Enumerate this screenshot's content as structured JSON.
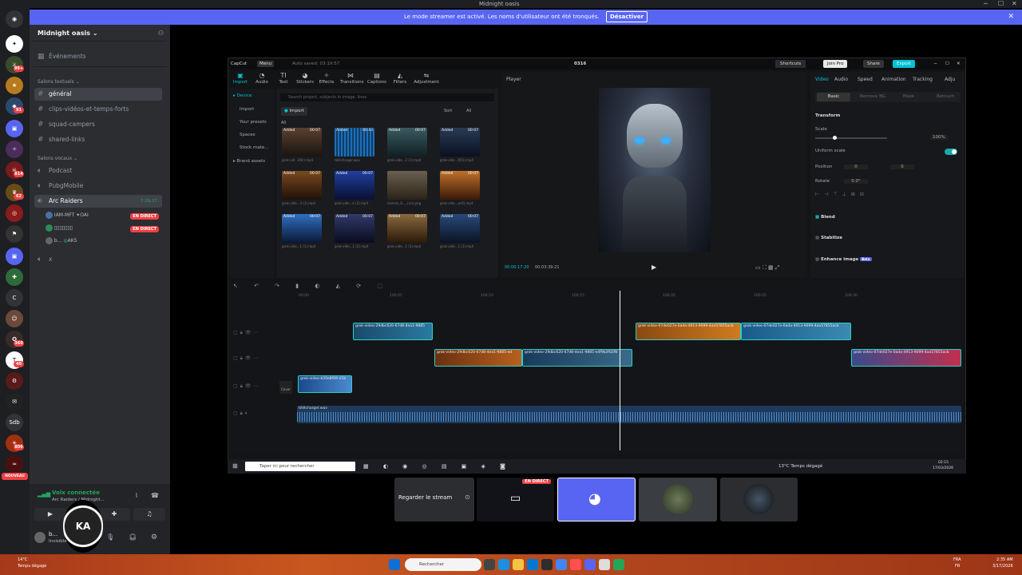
{
  "window": {
    "title": "Midnight oasis",
    "min": "─",
    "max": "☐",
    "close": "✕"
  },
  "guild_badges": [
    "99+",
    "91",
    "814",
    "62",
    "360",
    "40",
    "806"
  ],
  "guild_text": {
    "c": "C",
    "sdb": "Sdb",
    "new": "NOUVEAU"
  },
  "banner": {
    "text": "Le mode streamer est activé. Les noms d'utilisateur ont été tronqués.",
    "button": "Désactiver",
    "close": "✕"
  },
  "server": {
    "name": "Midnight oasis",
    "events": "Événements",
    "text_category": "Salons textuels",
    "text_channels": [
      "général",
      "clips-vidéos-et-temps-forts",
      "squad-campers",
      "shared-links"
    ],
    "voice_category": "Salons vocaux",
    "voice_channels": [
      "Podcast",
      "PubgMobile",
      "Arc Raiders"
    ],
    "active_time": "7:29:37",
    "voice_members": [
      {
        "name": "IAM-MFT",
        "tag": "OAI",
        "status": "EN DIRECT"
      },
      {
        "name": "▯▯▯▯▯▯▯",
        "tag": "",
        "status": "EN DIRECT"
      },
      {
        "name": "b...",
        "tag": "AKS",
        "status": ""
      }
    ],
    "last_channel": "x"
  },
  "voice": {
    "status": "Voix connectée",
    "channel": "Arc Raiders / Midnight..."
  },
  "user": {
    "name": "b...",
    "status": "Invisible"
  },
  "capcut": {
    "app": "CapCut",
    "menu": "Menu",
    "autosave": "Auto saved: 03:19:57",
    "project": "0316",
    "shortcuts": "Shortcuts",
    "join_pro": "Join Pro",
    "share": "Share",
    "export": "Export",
    "tools": [
      "Import",
      "Audio",
      "Text",
      "Stickers",
      "Effects",
      "Transitions",
      "Captions",
      "Filters",
      "Adjustment"
    ],
    "left_nav": [
      "Device",
      "Import",
      "Your presets",
      "Spaces",
      "Stock mate...",
      "Brand assets"
    ],
    "search_placeholder": "Search project, subjects in image, lines",
    "import_btn": "Import",
    "sort": "Sort",
    "all_label": "All",
    "all_filter": "All",
    "media": [
      {
        "label": "Added",
        "dur": "00:07",
        "file": "grok-vid...89c).mp4"
      },
      {
        "label": "Added",
        "dur": "00:43",
        "file": "télécharger.wav"
      },
      {
        "label": "Added",
        "dur": "00:07",
        "file": "grok-vide...2 (1).mp4"
      },
      {
        "label": "Added",
        "dur": "00:07",
        "file": "grok-vide...055).mp4"
      },
      {
        "label": "Added",
        "dur": "00:07",
        "file": "grok-vide...3 (1).mp4"
      },
      {
        "label": "Added",
        "dur": "00:07",
        "file": "grok-vide...k (2).mp4"
      },
      {
        "label": "",
        "dur": "",
        "file": "Gemini_G..._(no).png"
      },
      {
        "label": "Added",
        "dur": "00:07",
        "file": "grok-vide...ac6).mp4"
      },
      {
        "label": "Added",
        "dur": "00:07",
        "file": "grok-vide...1 (1).mp4"
      },
      {
        "label": "Added",
        "dur": "00:07",
        "file": "grok-vide...1 (2).mp4"
      },
      {
        "label": "Added",
        "dur": "00:07",
        "file": "grok-vide...1 (1).mp4"
      },
      {
        "label": "Added",
        "dur": "00:07",
        "file": "grok-vide...1 (1).mp4"
      }
    ],
    "player": {
      "title": "Player",
      "time": "00:00:17:20",
      "total": "00:03:39:21"
    },
    "right_tabs": [
      "Video",
      "Audio",
      "Speed",
      "Animation",
      "Tracking",
      "Adju"
    ],
    "sub_tabs": [
      "Basic",
      "Remove BG",
      "Mask",
      "Retouch"
    ],
    "transform": "Transform",
    "scale": "Scale",
    "scale_val": "100%",
    "uniform": "Uniform scale",
    "position": "Position",
    "pos_x": "0",
    "pos_y": "0",
    "rotate": "Rotate",
    "rot_val": "0.0°",
    "sections": [
      "Blend",
      "Stabilize",
      "Enhance image"
    ],
    "beta": "Beta",
    "ruler": [
      "00:00",
      "100:05",
      "100:10",
      "100:15",
      "100:20",
      "100:25",
      "100:30"
    ],
    "cover": "Cover",
    "clips": [
      {
        "name": "grok-video-29dbc620-67d8-4ea1-9885",
        "track": 0
      },
      {
        "name": "grok-video-07de027e-0ada-4913-9099-4aa57855acb",
        "track": 0
      },
      {
        "name": "grok-video-07de027e-0ada-4913-9099-4aa57855acb",
        "track": 0
      },
      {
        "name": "grok-video-29dbc620-67d8-4ea1-9885-ed",
        "track": 1
      },
      {
        "name": "grok-video-29dbc620-67d8-4ea1-9885-e4f9b3f02f8",
        "track": 1
      },
      {
        "name": "grok-video-07de027e-0ada-4913-9099-4aa57855acb",
        "track": 1
      },
      {
        "name": "grok-video-b20a8f09-d1b",
        "track": 2
      }
    ],
    "audio_clip": "télécharger.wav"
  },
  "inner_taskbar": {
    "search": "Taper ici pour rechercher",
    "weather": "13°C Temps dégagé",
    "time": "02:15",
    "date": "17/03/2026"
  },
  "stream": {
    "watch": "Regarder le stream",
    "live": "EN DIRECT"
  },
  "taskbar": {
    "weather_temp": "14°C",
    "weather_text": "Temps dégagé",
    "search": "Rechercher",
    "lang": "FRA",
    "lang2": "FR",
    "time": "2:35 AM",
    "date": "3/17/2026"
  },
  "colors": {
    "accent": "#5865f2",
    "live": "#f23f42",
    "export": "#00c2d4",
    "capcut_teal": "#1aa8a8"
  }
}
